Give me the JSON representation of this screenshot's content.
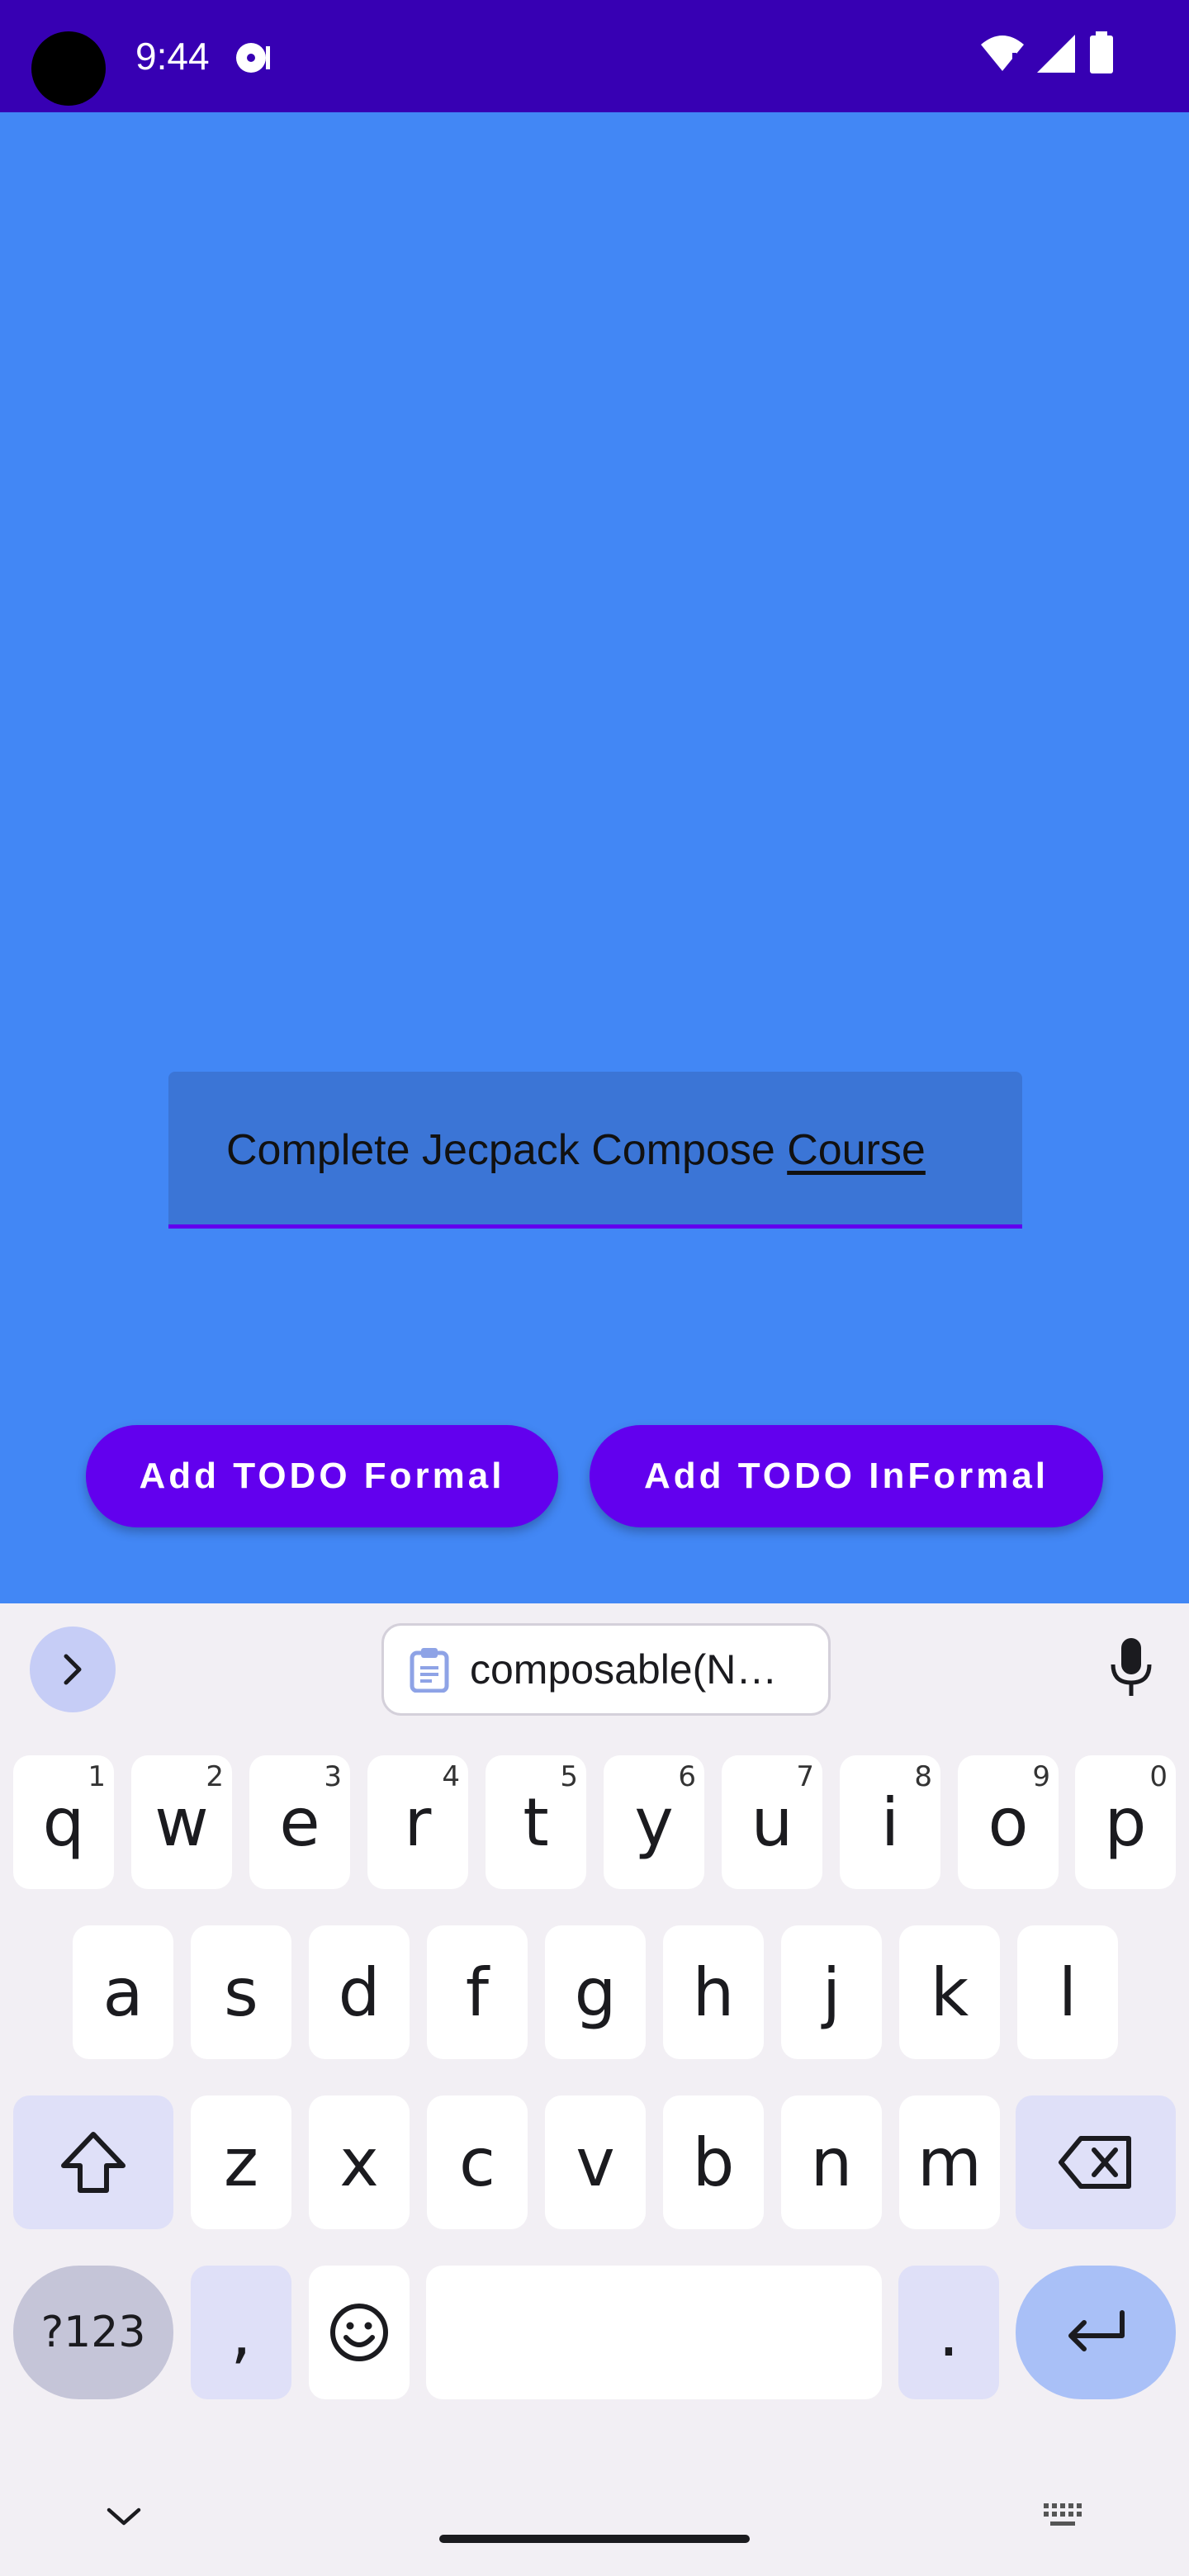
{
  "status_bar": {
    "time": "9:44"
  },
  "app": {
    "todo_field": {
      "value_prefix": "Complete Jecpack Compose ",
      "value_underlined": "Course"
    },
    "buttons": {
      "formal": "Add TODO Formal",
      "informal": "Add TODO InFormal"
    },
    "colors": {
      "background": "#4287f5",
      "button": "#6200ee",
      "status_bar": "#3700b3"
    }
  },
  "keyboard": {
    "clipboard_suggestion": "composable(N…",
    "row1": [
      {
        "key": "q",
        "hint": "1"
      },
      {
        "key": "w",
        "hint": "2"
      },
      {
        "key": "e",
        "hint": "3"
      },
      {
        "key": "r",
        "hint": "4"
      },
      {
        "key": "t",
        "hint": "5"
      },
      {
        "key": "y",
        "hint": "6"
      },
      {
        "key": "u",
        "hint": "7"
      },
      {
        "key": "i",
        "hint": "8"
      },
      {
        "key": "o",
        "hint": "9"
      },
      {
        "key": "p",
        "hint": "0"
      }
    ],
    "row2": [
      "a",
      "s",
      "d",
      "f",
      "g",
      "h",
      "j",
      "k",
      "l"
    ],
    "row3": [
      "z",
      "x",
      "c",
      "v",
      "b",
      "n",
      "m"
    ],
    "symbols_label": "?123",
    "comma": ",",
    "period": "."
  }
}
